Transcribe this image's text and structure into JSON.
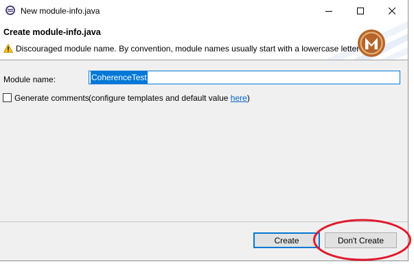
{
  "window": {
    "title": "New module-info.java",
    "controls": {
      "minimize": "minimize",
      "maximize": "maximize",
      "close": "close"
    }
  },
  "banner": {
    "title": "Create module-info.java",
    "message": "Discouraged module name. By convention, module names usually start with a lowercase letter",
    "logo_letter": "M"
  },
  "form": {
    "module_name_label": "Module name:",
    "module_name_value": "CoherenceTest",
    "generate_comments_label": "Generate comments",
    "generate_comments_checked": false,
    "hint_prefix": "(configure templates and default value ",
    "hint_link": "here",
    "hint_suffix": ")"
  },
  "buttons": {
    "create": "Create",
    "dont_create": "Don't Create"
  },
  "colors": {
    "accent": "#0078d7",
    "annotation": "#e0192c",
    "logo": "#b5652a"
  }
}
